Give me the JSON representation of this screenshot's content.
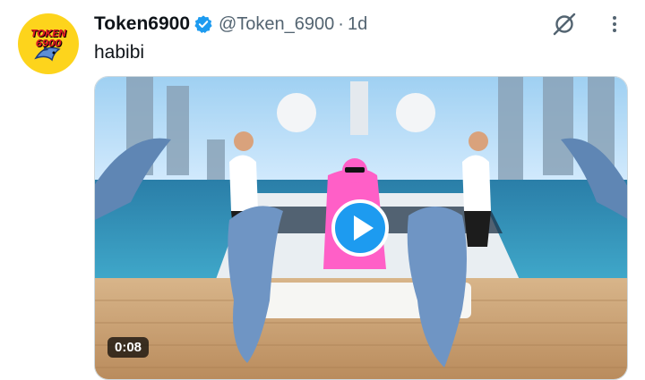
{
  "tweet": {
    "author": {
      "display_name": "Token6900",
      "handle": "@Token_6900",
      "verified": true,
      "avatar_text": "TOKEN 6900",
      "avatar_icon": "dolphin-logo-icon"
    },
    "separator": "·",
    "timestamp": "1d",
    "text": "habibi",
    "media": {
      "type": "video",
      "duration": "0:08",
      "play_icon": "play-icon"
    },
    "actions": {
      "grok_icon": "grok-icon",
      "more_icon": "more-vertical-icon"
    }
  },
  "colors": {
    "accent": "#1d9bf0",
    "text_primary": "#0f1419",
    "text_secondary": "#536471",
    "avatar_bg": "#fdd41c",
    "avatar_text": "#d81b23"
  }
}
